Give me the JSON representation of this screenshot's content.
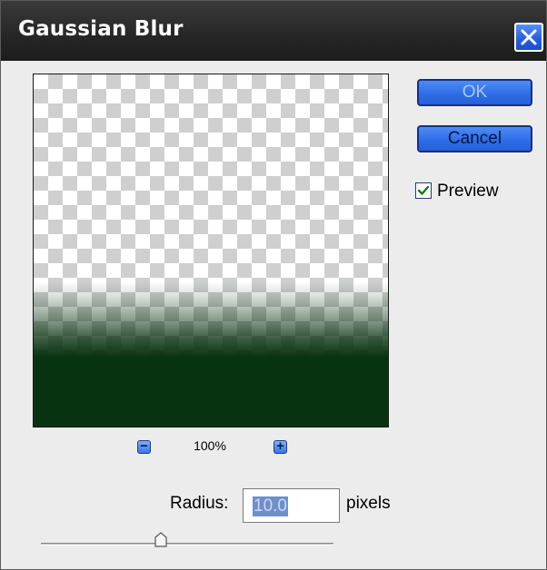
{
  "dialog": {
    "title": "Gaussian Blur"
  },
  "buttons": {
    "ok_label": "OK",
    "cancel_label": "Cancel"
  },
  "preview_option": {
    "label": "Preview",
    "checked": true
  },
  "zoom": {
    "level": "100%",
    "zoom_out_symbol": "−",
    "zoom_in_symbol": "+"
  },
  "radius": {
    "label": "Radius:",
    "value": "10.0",
    "unit": "pixels",
    "slider_fraction": 0.41
  },
  "icons": {
    "close": "close-icon",
    "zoom_out": "minus-icon",
    "zoom_in": "plus-icon",
    "check": "checkmark-icon",
    "slider_thumb": "slider-thumb-icon"
  },
  "colors": {
    "title_bar": "#262626",
    "button_blue": "#2d6ce6",
    "preview_green": "#083310",
    "selection": "#6f8fc8"
  }
}
